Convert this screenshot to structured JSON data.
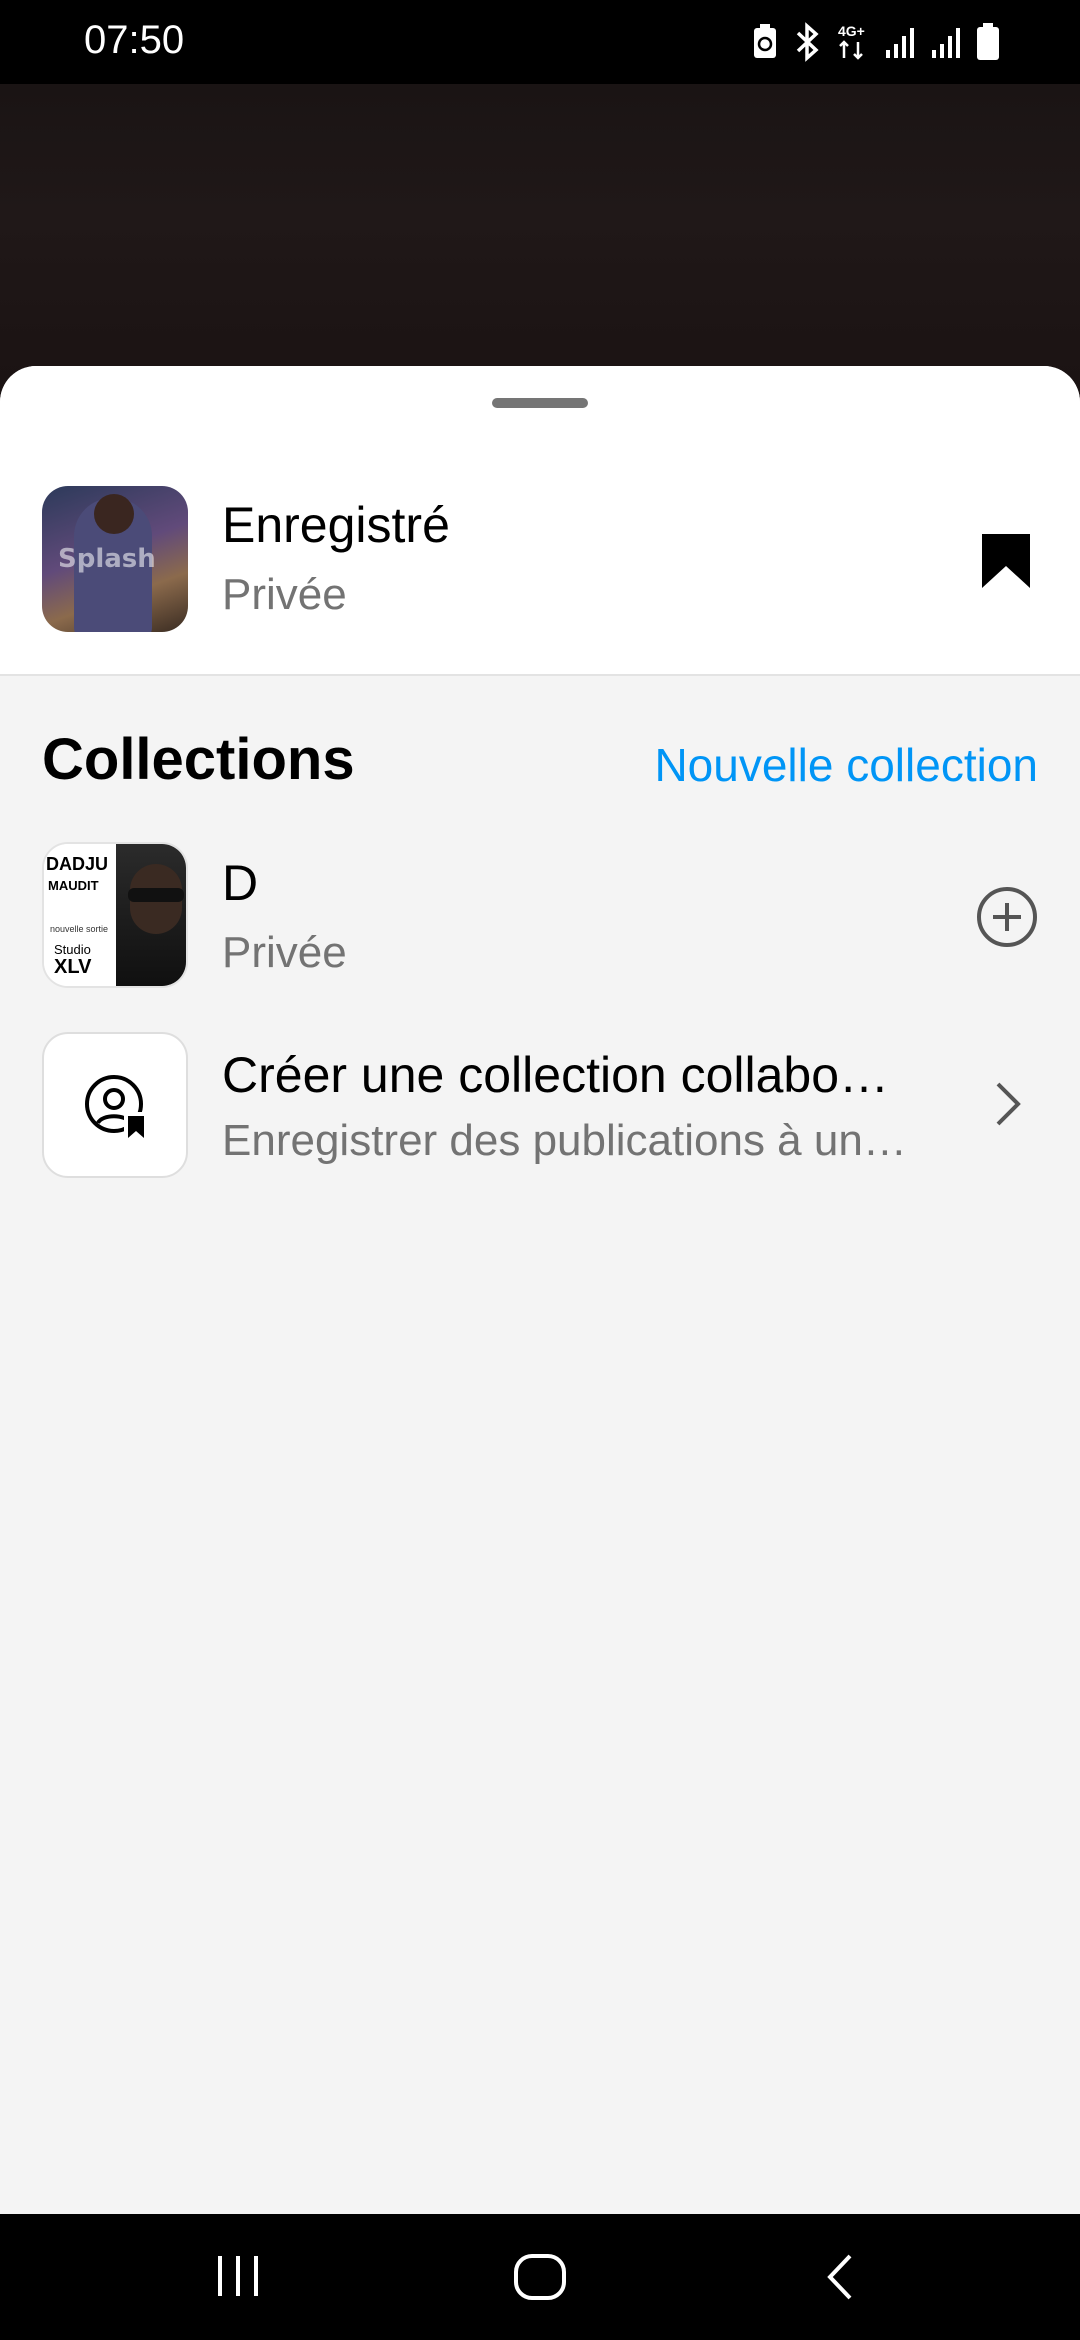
{
  "status_bar": {
    "time": "07:50",
    "icons": [
      "battery-saver-icon",
      "bluetooth-icon",
      "mobile-data-4g-icon",
      "signal-icon",
      "signal-icon",
      "battery-icon"
    ]
  },
  "saved": {
    "title": "Enregistré",
    "subtitle": "Privée",
    "thumb_watermark": "Splash",
    "bookmark_icon": "bookmark-filled-icon"
  },
  "collections": {
    "title": "Collections",
    "new_label": "Nouvelle collection",
    "items": [
      {
        "title": "D",
        "subtitle": "Privée",
        "thumb_text": [
          "DADJU",
          "MAUDIT",
          "nouvelle sortie",
          "Studio",
          "XLV"
        ],
        "action_icon": "add-circle-icon"
      },
      {
        "title": "Créer une collection collabo…",
        "subtitle": "Enregistrer des publications à un…",
        "icon": "collab-user-bookmark-icon",
        "action_icon": "chevron-right-icon"
      }
    ]
  },
  "nav": [
    "recent-apps-icon",
    "home-icon",
    "back-icon"
  ],
  "colors": {
    "accent": "#0095f6",
    "sheet_bg": "#f4f4f4",
    "muted_text": "#737373"
  }
}
